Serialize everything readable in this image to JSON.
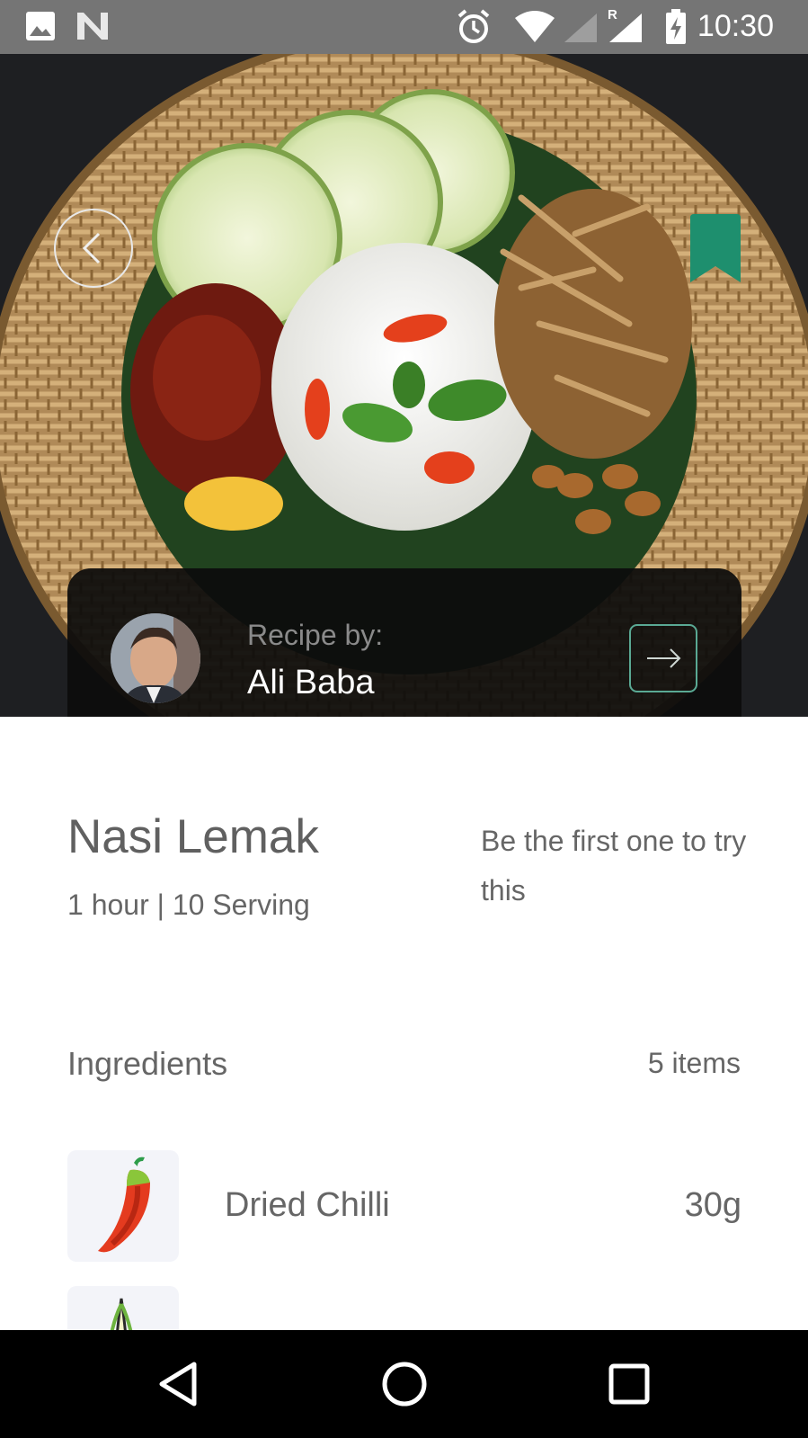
{
  "status_bar": {
    "time": "10:30",
    "icons": [
      "image-icon",
      "n-logo-icon",
      "alarm-icon",
      "wifi-icon",
      "signal-icon",
      "battery-charging-icon"
    ],
    "roaming_mark": "R"
  },
  "hero": {
    "image": "nasi-lemak-photo",
    "back_icon": "chevron-left-icon",
    "bookmark_icon": "bookmark-icon",
    "accent_color": "#1e8f6e"
  },
  "author_card": {
    "label": "Recipe by:",
    "name": "Ali Baba",
    "arrow_icon": "arrow-right-icon"
  },
  "recipe": {
    "title": "Nasi Lemak",
    "meta": "1 hour | 10 Serving",
    "try_text": "Be the first one to try this"
  },
  "ingredients": {
    "heading": "Ingredients",
    "count": "5 items",
    "items": [
      {
        "name": "Dried Chilli",
        "qty": "30g",
        "icon": "chilli-icon"
      },
      {
        "name": "",
        "qty": "",
        "icon": "lemongrass-icon"
      }
    ]
  },
  "nav_bar": {
    "back": "nav-back-icon",
    "home": "nav-home-icon",
    "recents": "nav-recents-icon"
  }
}
